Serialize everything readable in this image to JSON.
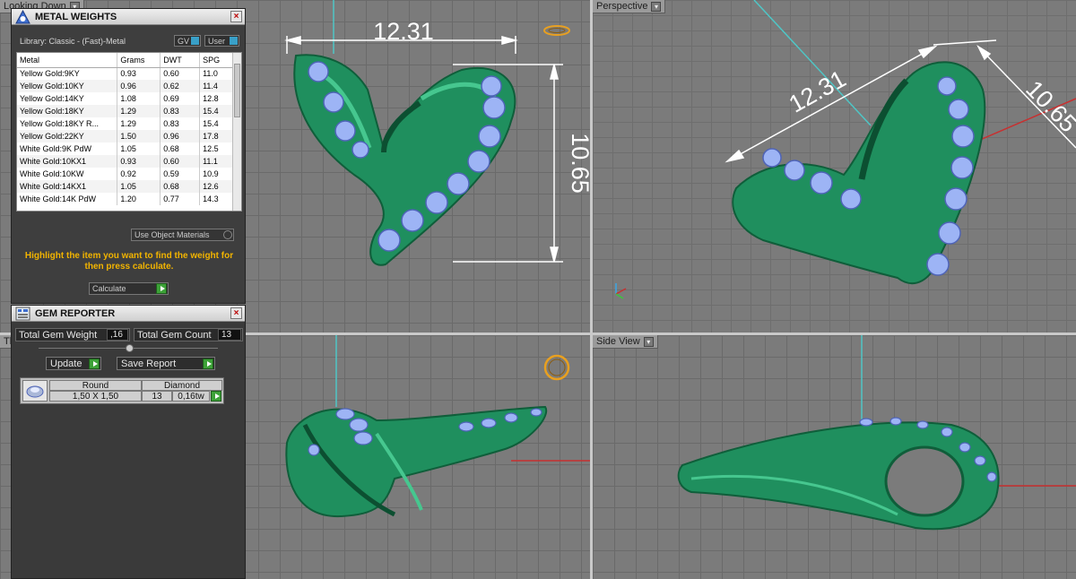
{
  "viewports": {
    "top_label": "Looking Down",
    "perspective_label": "Perspective",
    "front_label": "Th",
    "side_label": "Side View"
  },
  "dimensions": {
    "width_top": "12.31",
    "height_top": "10.65",
    "width_persp": "12.31",
    "height_persp": "10.65"
  },
  "metal_weights": {
    "title": "METAL WEIGHTS",
    "library": "Library: Classic - (Fast)-Metal",
    "gv_label": "GV",
    "user_label": "User",
    "columns": [
      "Metal",
      "Grams",
      "DWT",
      "SPG"
    ],
    "rows": [
      [
        "Yellow Gold:9KY",
        "0.93",
        "0.60",
        "11.0"
      ],
      [
        "Yellow Gold:10KY",
        "0.96",
        "0.62",
        "11.4"
      ],
      [
        "Yellow Gold:14KY",
        "1.08",
        "0.69",
        "12.8"
      ],
      [
        "Yellow Gold:18KY",
        "1.29",
        "0.83",
        "15.4"
      ],
      [
        "Yellow Gold:18KY R...",
        "1.29",
        "0.83",
        "15.4"
      ],
      [
        "Yellow Gold:22KY",
        "1.50",
        "0.96",
        "17.8"
      ],
      [
        "White Gold:9K PdW",
        "1.05",
        "0.68",
        "12.5"
      ],
      [
        "White Gold:10KX1",
        "0.93",
        "0.60",
        "11.1"
      ],
      [
        "White Gold:10KW",
        "0.92",
        "0.59",
        "10.9"
      ],
      [
        "White Gold:14KX1",
        "1.05",
        "0.68",
        "12.6"
      ],
      [
        "White Gold:14K PdW",
        "1.20",
        "0.77",
        "14.3"
      ]
    ],
    "use_object_materials": "Use Object Materials",
    "hint": "Highlight the item you want to find the weight for then press calculate.",
    "calculate_label": "Calculate"
  },
  "gem_reporter": {
    "title": "GEM REPORTER",
    "total_weight_label": "Total Gem Weight",
    "total_weight_value": ",16",
    "total_count_label": "Total Gem Count",
    "total_count_value": "13",
    "update_label": "Update",
    "save_report_label": "Save Report",
    "gem": {
      "shape": "Round",
      "material": "Diamond",
      "size": "1,50 X 1,50",
      "count": "13",
      "weight": "0,16tw"
    }
  },
  "colors": {
    "metal_green": "#1f8f5e",
    "gem_blue": "#9db4f5",
    "dimension_white": "#ffffff",
    "hint_yellow": "#f2b400"
  }
}
